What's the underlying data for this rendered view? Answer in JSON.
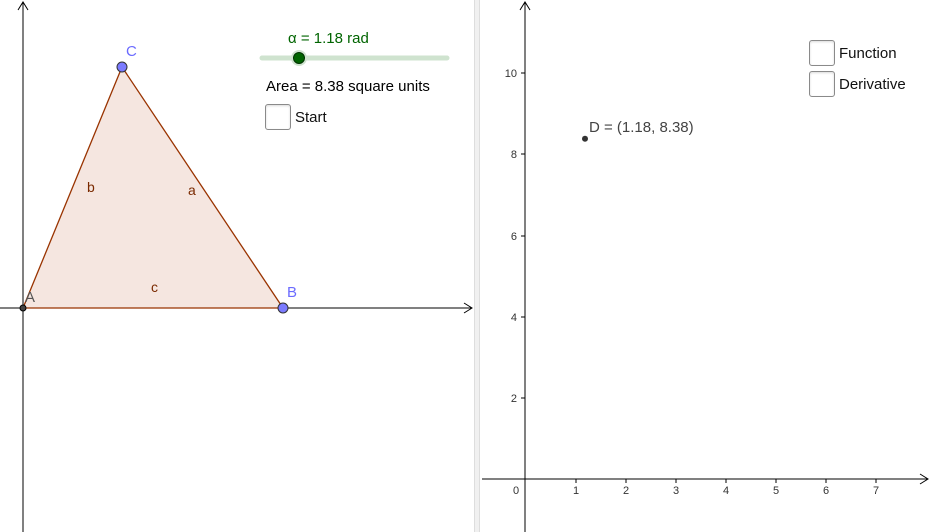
{
  "left": {
    "slider": {
      "label": "α = 1.18 rad",
      "value": 1.18,
      "color": "#006400"
    },
    "area_text": "Area = 8.38 square units",
    "start_checkbox": {
      "label": "Start",
      "checked": false
    },
    "points": {
      "A": "A",
      "B": "B",
      "C": "C"
    },
    "sides": {
      "a": "a",
      "b": "b",
      "c": "c"
    },
    "colors": {
      "fill": "#f5e6e0",
      "edge": "#993300",
      "point": "#7b7bff",
      "point_label": "#6b6bff",
      "side_label": "#7a2a00"
    }
  },
  "right": {
    "checkboxes": [
      {
        "label": "Function",
        "checked": false
      },
      {
        "label": "Derivative",
        "checked": false
      }
    ],
    "point_d": {
      "label": "D = (1.18, 8.38)",
      "x": 1.18,
      "y": 8.38
    },
    "x_ticks": [
      "0",
      "1",
      "2",
      "3",
      "4",
      "5",
      "6",
      "7"
    ],
    "y_ticks": [
      "2",
      "4",
      "6",
      "8",
      "10"
    ]
  }
}
